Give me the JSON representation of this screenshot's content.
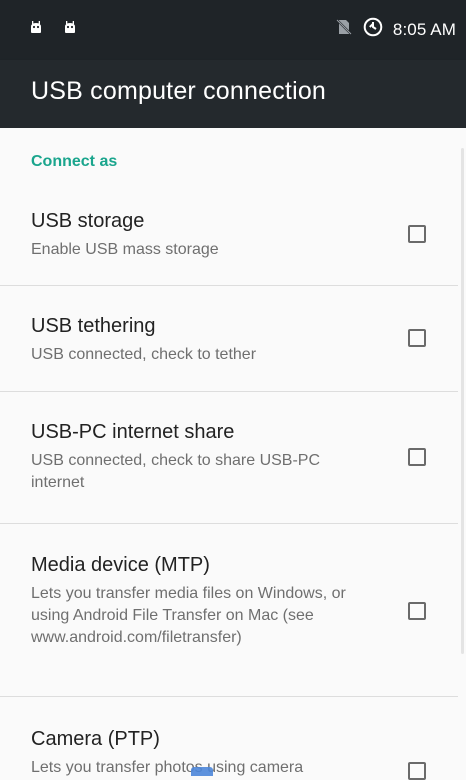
{
  "status_bar": {
    "left_icons": [
      "android-icon",
      "android-icon"
    ],
    "no_sim_icon": "no-sim-icon",
    "data_saver_icon": "data-saver-icon",
    "time": "8:05 AM"
  },
  "toolbar": {
    "title": "USB computer connection"
  },
  "section": {
    "header": "Connect as"
  },
  "items": [
    {
      "title": "USB storage",
      "summary": "Enable USB mass storage",
      "checked": false
    },
    {
      "title": "USB tethering",
      "summary": "USB connected, check to tether",
      "checked": false
    },
    {
      "title": "USB-PC internet share",
      "summary": "USB connected, check to share USB-PC internet",
      "checked": false
    },
    {
      "title": "Media device (MTP)",
      "summary": "Lets you transfer media files on Windows, or using Android File Transfer on Mac (see www.android.com/filetransfer)",
      "checked": false
    },
    {
      "title": "Camera (PTP)",
      "summary": "Lets you transfer photos using camera",
      "checked": false
    }
  ],
  "colors": {
    "status_bar": "#1f2428",
    "toolbar": "#24292d",
    "accent": "#1aa58d",
    "background": "#fafafa"
  }
}
